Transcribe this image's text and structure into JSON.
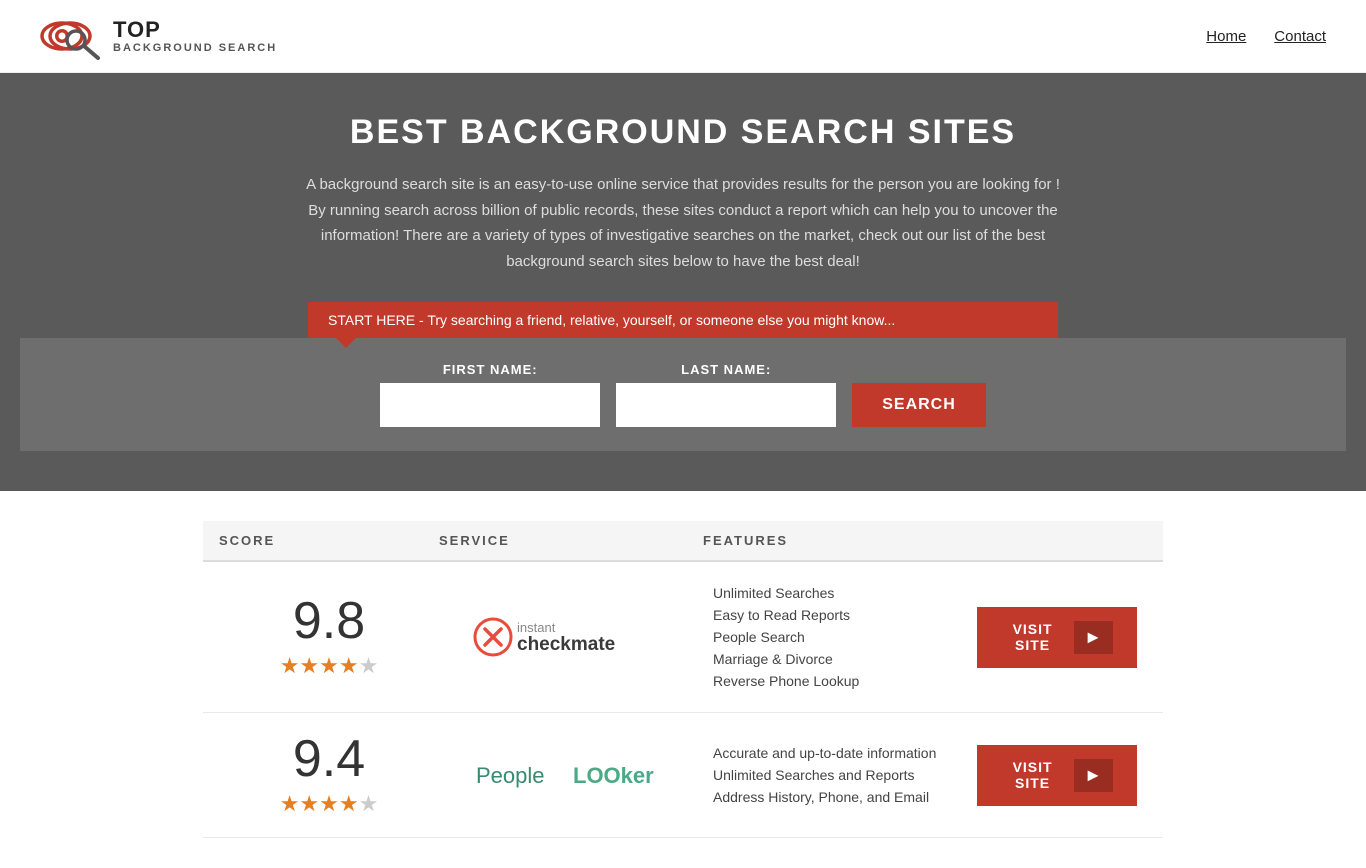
{
  "header": {
    "logo_top": "TOP",
    "logo_sub": "BACKGROUND SEARCH",
    "nav": {
      "home": "Home",
      "contact": "Contact"
    }
  },
  "hero": {
    "title": "BEST BACKGROUND SEARCH SITES",
    "description": "A background search site is an easy-to-use online service that provides results  for the person you are looking for ! By  running  search across billion of public records, these sites conduct  a report which can help you to uncover the information! There are a variety of types of investigative searches on the market, check out our  list of the best background search sites below to have the best deal!",
    "banner_text": "START HERE - Try searching a friend, relative, yourself, or someone else you might know...",
    "form": {
      "first_name_label": "FIRST NAME:",
      "last_name_label": "LAST NAME:",
      "search_button": "SEARCH"
    }
  },
  "table": {
    "headers": {
      "score": "SCORE",
      "service": "SERVICE",
      "features": "FEATURES"
    },
    "rows": [
      {
        "score": "9.8",
        "stars": "★★★★★",
        "service_name": "Instant Checkmate",
        "features": [
          "Unlimited Searches",
          "Easy to Read Reports",
          "People Search",
          "Marriage & Divorce",
          "Reverse Phone Lookup"
        ],
        "visit_label": "VISIT SITE"
      },
      {
        "score": "9.4",
        "stars": "★★★★★",
        "service_name": "PeopleLooker",
        "features": [
          "Accurate and up-to-date information",
          "Unlimited Searches and Reports",
          "Address History, Phone, and Email"
        ],
        "visit_label": "VISIT SITE"
      }
    ]
  }
}
